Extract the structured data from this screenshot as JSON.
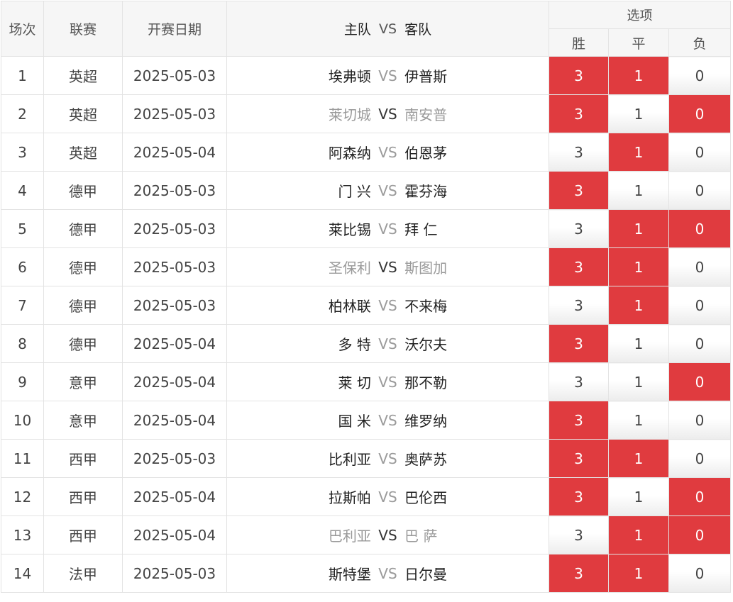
{
  "header": {
    "num": "场次",
    "league": "联赛",
    "date": "开赛日期",
    "home": "主队",
    "vs": "VS",
    "away": "客队",
    "options": "选项",
    "win": "胜",
    "draw": "平",
    "loss": "负"
  },
  "colors": {
    "selected": "#e03b3f",
    "muted_team": "#9a9a9a"
  },
  "rows": [
    {
      "num": "1",
      "league": "英超",
      "date": "2025-05-03",
      "home": "埃弗顿",
      "vs": "VS",
      "away": "伊普斯",
      "muted": false,
      "win": "3",
      "draw": "1",
      "loss": "0",
      "win_sel": true,
      "draw_sel": true,
      "loss_sel": false
    },
    {
      "num": "2",
      "league": "英超",
      "date": "2025-05-03",
      "home": "莱切城",
      "vs": "VS",
      "away": "南安普",
      "muted": true,
      "win": "3",
      "draw": "1",
      "loss": "0",
      "win_sel": true,
      "draw_sel": false,
      "loss_sel": true
    },
    {
      "num": "3",
      "league": "英超",
      "date": "2025-05-04",
      "home": "阿森纳",
      "vs": "VS",
      "away": "伯恩茅",
      "muted": false,
      "win": "3",
      "draw": "1",
      "loss": "0",
      "win_sel": false,
      "draw_sel": true,
      "loss_sel": false
    },
    {
      "num": "4",
      "league": "德甲",
      "date": "2025-05-03",
      "home": "门 兴",
      "vs": "VS",
      "away": "霍芬海",
      "muted": false,
      "win": "3",
      "draw": "1",
      "loss": "0",
      "win_sel": true,
      "draw_sel": false,
      "loss_sel": false
    },
    {
      "num": "5",
      "league": "德甲",
      "date": "2025-05-03",
      "home": "莱比锡",
      "vs": "VS",
      "away": "拜 仁",
      "muted": false,
      "win": "3",
      "draw": "1",
      "loss": "0",
      "win_sel": false,
      "draw_sel": true,
      "loss_sel": true
    },
    {
      "num": "6",
      "league": "德甲",
      "date": "2025-05-03",
      "home": "圣保利",
      "vs": "VS",
      "away": "斯图加",
      "muted": true,
      "win": "3",
      "draw": "1",
      "loss": "0",
      "win_sel": true,
      "draw_sel": true,
      "loss_sel": false
    },
    {
      "num": "7",
      "league": "德甲",
      "date": "2025-05-03",
      "home": "柏林联",
      "vs": "VS",
      "away": "不来梅",
      "muted": false,
      "win": "3",
      "draw": "1",
      "loss": "0",
      "win_sel": false,
      "draw_sel": true,
      "loss_sel": false
    },
    {
      "num": "8",
      "league": "德甲",
      "date": "2025-05-04",
      "home": "多 特",
      "vs": "VS",
      "away": "沃尔夫",
      "muted": false,
      "win": "3",
      "draw": "1",
      "loss": "0",
      "win_sel": true,
      "draw_sel": false,
      "loss_sel": false
    },
    {
      "num": "9",
      "league": "意甲",
      "date": "2025-05-04",
      "home": "莱 切",
      "vs": "VS",
      "away": "那不勒",
      "muted": false,
      "win": "3",
      "draw": "1",
      "loss": "0",
      "win_sel": false,
      "draw_sel": false,
      "loss_sel": true
    },
    {
      "num": "10",
      "league": "意甲",
      "date": "2025-05-04",
      "home": "国 米",
      "vs": "VS",
      "away": "维罗纳",
      "muted": false,
      "win": "3",
      "draw": "1",
      "loss": "0",
      "win_sel": true,
      "draw_sel": false,
      "loss_sel": false
    },
    {
      "num": "11",
      "league": "西甲",
      "date": "2025-05-03",
      "home": "比利亚",
      "vs": "VS",
      "away": "奥萨苏",
      "muted": false,
      "win": "3",
      "draw": "1",
      "loss": "0",
      "win_sel": true,
      "draw_sel": true,
      "loss_sel": false
    },
    {
      "num": "12",
      "league": "西甲",
      "date": "2025-05-04",
      "home": "拉斯帕",
      "vs": "VS",
      "away": "巴伦西",
      "muted": false,
      "win": "3",
      "draw": "1",
      "loss": "0",
      "win_sel": true,
      "draw_sel": false,
      "loss_sel": true
    },
    {
      "num": "13",
      "league": "西甲",
      "date": "2025-05-04",
      "home": "巴利亚",
      "vs": "VS",
      "away": "巴 萨",
      "muted": true,
      "win": "3",
      "draw": "1",
      "loss": "0",
      "win_sel": false,
      "draw_sel": true,
      "loss_sel": true
    },
    {
      "num": "14",
      "league": "法甲",
      "date": "2025-05-03",
      "home": "斯特堡",
      "vs": "VS",
      "away": "日尔曼",
      "muted": false,
      "win": "3",
      "draw": "1",
      "loss": "0",
      "win_sel": true,
      "draw_sel": true,
      "loss_sel": false
    }
  ]
}
